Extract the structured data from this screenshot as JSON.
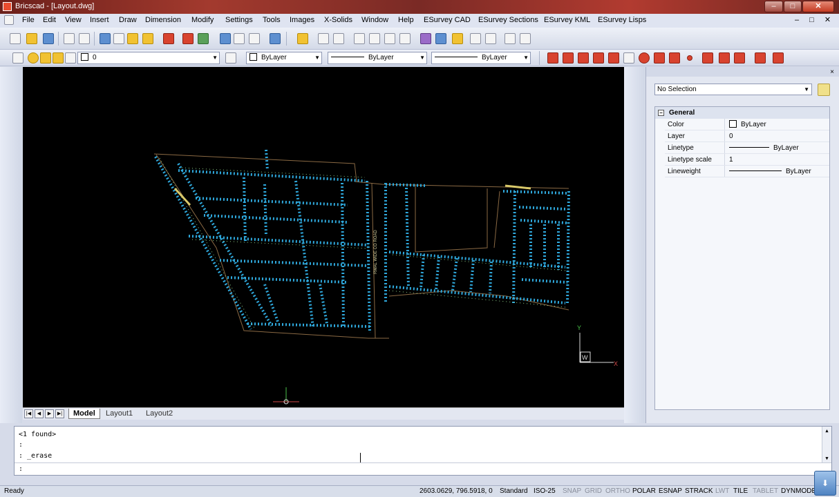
{
  "window": {
    "title": "Bricscad - [Layout.dwg]",
    "min": "–",
    "max": "□",
    "close": "✕"
  },
  "menubar": {
    "items": [
      "File",
      "Edit",
      "View",
      "Insert",
      "Draw",
      "Dimension",
      "Modify",
      "Settings",
      "Tools",
      "Images",
      "X-Solids",
      "Window",
      "Help",
      "ESurvey CAD",
      "ESurvey Sections",
      "ESurvey KML",
      "ESurvey Lisps"
    ],
    "doc_controls": "– □ ✕"
  },
  "properties_toolbar": {
    "layer": "0",
    "color": "ByLayer",
    "linetype": "ByLayer",
    "lineweight": "ByLayer"
  },
  "drawing_tabs": {
    "nav": [
      "|◀",
      "◀",
      "▶",
      "▶|"
    ],
    "tabs": [
      "Model",
      "Layout1",
      "Layout2"
    ]
  },
  "canvas": {
    "road_label": "RWAL WIDE CO ROAD",
    "ucs_y": "Y",
    "ucs_x": "X",
    "ucs_w": "W"
  },
  "properties_panel": {
    "close": "×",
    "selection": "No Selection",
    "category": "General",
    "rows": [
      {
        "name": "Color",
        "value": "ByLayer"
      },
      {
        "name": "Layer",
        "value": "0"
      },
      {
        "name": "Linetype",
        "value": "ByLayer"
      },
      {
        "name": "Linetype scale",
        "value": "1"
      },
      {
        "name": "Lineweight",
        "value": "ByLayer"
      }
    ]
  },
  "command_line": {
    "history": [
      "<1 found>",
      ":",
      ": _erase"
    ],
    "prompt": ":"
  },
  "statusbar": {
    "ready": "Ready",
    "coordinates": "2603.0629, 796.5918, 0",
    "text_style": "Standard",
    "dim_style": "ISO-25",
    "toggles": [
      {
        "label": "SNAP",
        "on": false
      },
      {
        "label": "GRID",
        "on": false
      },
      {
        "label": "ORTHO",
        "on": false
      },
      {
        "label": "POLAR",
        "on": true
      },
      {
        "label": "ESNAP",
        "on": true
      },
      {
        "label": "STRACK",
        "on": true
      },
      {
        "label": "LWT",
        "on": false
      },
      {
        "label": "TILE",
        "on": true
      },
      {
        "label": "TABLET",
        "on": false
      },
      {
        "label": "DYNMODE",
        "on": true
      }
    ]
  },
  "colors": {
    "drawing_cyan": "#2fa9dd",
    "drawing_green": "#8fd18a",
    "drawing_brown": "#8b6a44",
    "canvas_bg": "#000000"
  }
}
